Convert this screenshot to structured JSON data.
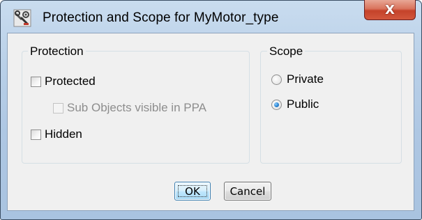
{
  "window": {
    "title": "Protection and Scope for MyMotor_type",
    "close_glyph": "X",
    "icon": "wrench-gear-icon"
  },
  "protection_group": {
    "legend": "Protection",
    "protected": {
      "label": "Protected",
      "checked": false
    },
    "sub_objects": {
      "label": "Sub Objects visible in PPA",
      "checked": false,
      "enabled": false
    },
    "hidden": {
      "label": "Hidden",
      "checked": false
    }
  },
  "scope_group": {
    "legend": "Scope",
    "options": [
      {
        "label": "Private",
        "selected": false
      },
      {
        "label": "Public",
        "selected": true
      }
    ]
  },
  "buttons": {
    "ok": "OK",
    "cancel": "Cancel"
  },
  "colors": {
    "titlebar": "#b9d0e8",
    "close_button": "#c5422a",
    "dialog_background": "#f0f0f0",
    "default_button_border": "#3c7fb1",
    "radio_selected": "#2b84d2"
  }
}
